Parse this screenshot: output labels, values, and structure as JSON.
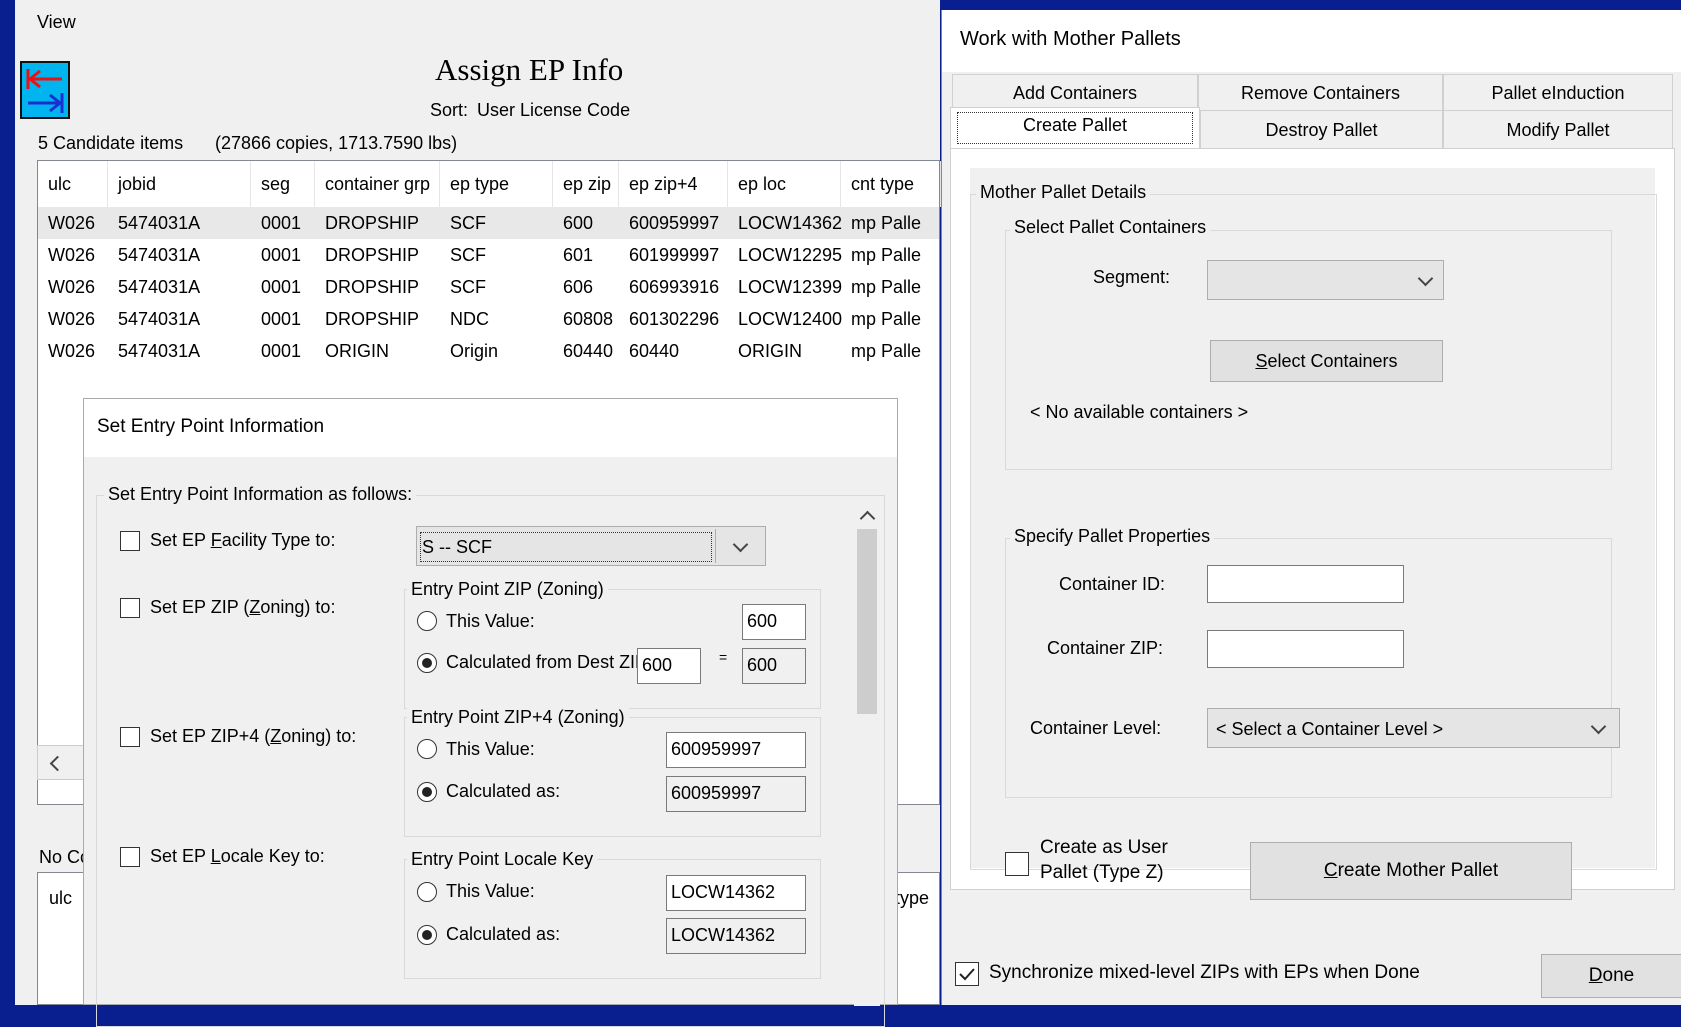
{
  "main_window": {
    "menu_view": "View",
    "title": "Assign EP Info",
    "sort_label": "Sort:",
    "sort_value": "User License Code",
    "candidate_count": "5 Candidate items",
    "candidate_summary": "(27866 copies, 1713.7590 lbs)",
    "columns": [
      "ulc",
      "jobid",
      "seg",
      "container grp",
      "ep type",
      "ep zip",
      "ep zip+4",
      "ep loc",
      "cnt type"
    ],
    "rows": [
      [
        "W026",
        "5474031A",
        "0001",
        "DROPSHIP",
        "SCF",
        "600",
        "600959997",
        "LOCW14362",
        "mp Palle"
      ],
      [
        "W026",
        "5474031A",
        "0001",
        "DROPSHIP",
        "SCF",
        "601",
        "601999997",
        "LOCW12295",
        "mp Palle"
      ],
      [
        "W026",
        "5474031A",
        "0001",
        "DROPSHIP",
        "SCF",
        "606",
        "606993916",
        "LOCW12399",
        "mp Palle"
      ],
      [
        "W026",
        "5474031A",
        "0001",
        "DROPSHIP",
        "NDC",
        "60808",
        "601302296",
        "LOCW12400",
        "mp Palle"
      ],
      [
        "W026",
        "5474031A",
        "0001",
        "ORIGIN",
        "Origin",
        "60440",
        "60440",
        "ORIGIN",
        "mp Palle"
      ]
    ],
    "lower_label_partial": "No Cc",
    "lower_col_ulc": "ulc",
    "lower_col_type": "type"
  },
  "ep_dialog": {
    "title": "Set Entry Point Information",
    "group_title": "Set Entry Point Information as follows:",
    "facility": {
      "label_pre": "Set EP ",
      "label_u": "F",
      "label_post": "acility Type to:",
      "value": "S -- SCF"
    },
    "zip": {
      "label_pre": "Set EP ZIP (",
      "label_u": "Z",
      "label_post": "oning) to:",
      "group": "Entry Point ZIP (Zoning)",
      "this_value_label": "This Value:",
      "this_value": "600",
      "calc_label": "Calculated from Dest ZIP",
      "calc_input": "600",
      "equals": "=",
      "calc_result": "600"
    },
    "zip4": {
      "label_pre": "Set EP ZIP+4 (",
      "label_u": "Z",
      "label_post": "oning) to:",
      "group": "Entry Point ZIP+4 (Zoning)",
      "this_value_label": "This Value:",
      "this_value": "600959997",
      "calc_label": "Calculated as:",
      "calc_result": "600959997"
    },
    "locale": {
      "label_pre": "Set EP ",
      "label_u": "L",
      "label_post": "ocale Key to:",
      "group": "Entry Point Locale Key",
      "this_value_label": "This Value:",
      "this_value": "LOCW14362",
      "calc_label": "Calculated as:",
      "calc_result": "LOCW14362"
    }
  },
  "mp_window": {
    "title": "Work with Mother Pallets",
    "tabs_row1": [
      "Add Containers",
      "Remove Containers",
      "Pallet eInduction"
    ],
    "tabs_row2": [
      "Create Pallet",
      "Destroy Pallet",
      "Modify Pallet"
    ],
    "details_group": "Mother Pallet Details",
    "select_group": "Select Pallet Containers",
    "segment_label": "Segment:",
    "select_btn_u": "S",
    "select_btn_rest": "elect Containers",
    "no_containers": "< No available containers >",
    "props_group": "Specify Pallet Properties",
    "container_id_label": "Container ID:",
    "container_zip_label": "Container ZIP:",
    "container_level_label": "Container Level:",
    "container_level_value": "< Select a Container Level >",
    "user_pallet_line1": "Create as User",
    "user_pallet_line2": "Pallet (Type Z)",
    "create_btn_u": "C",
    "create_btn_rest": "reate Mother Pallet",
    "sync_label": "Synchronize mixed-level ZIPs with EPs when Done",
    "done_u": "D",
    "done_rest": "one"
  }
}
